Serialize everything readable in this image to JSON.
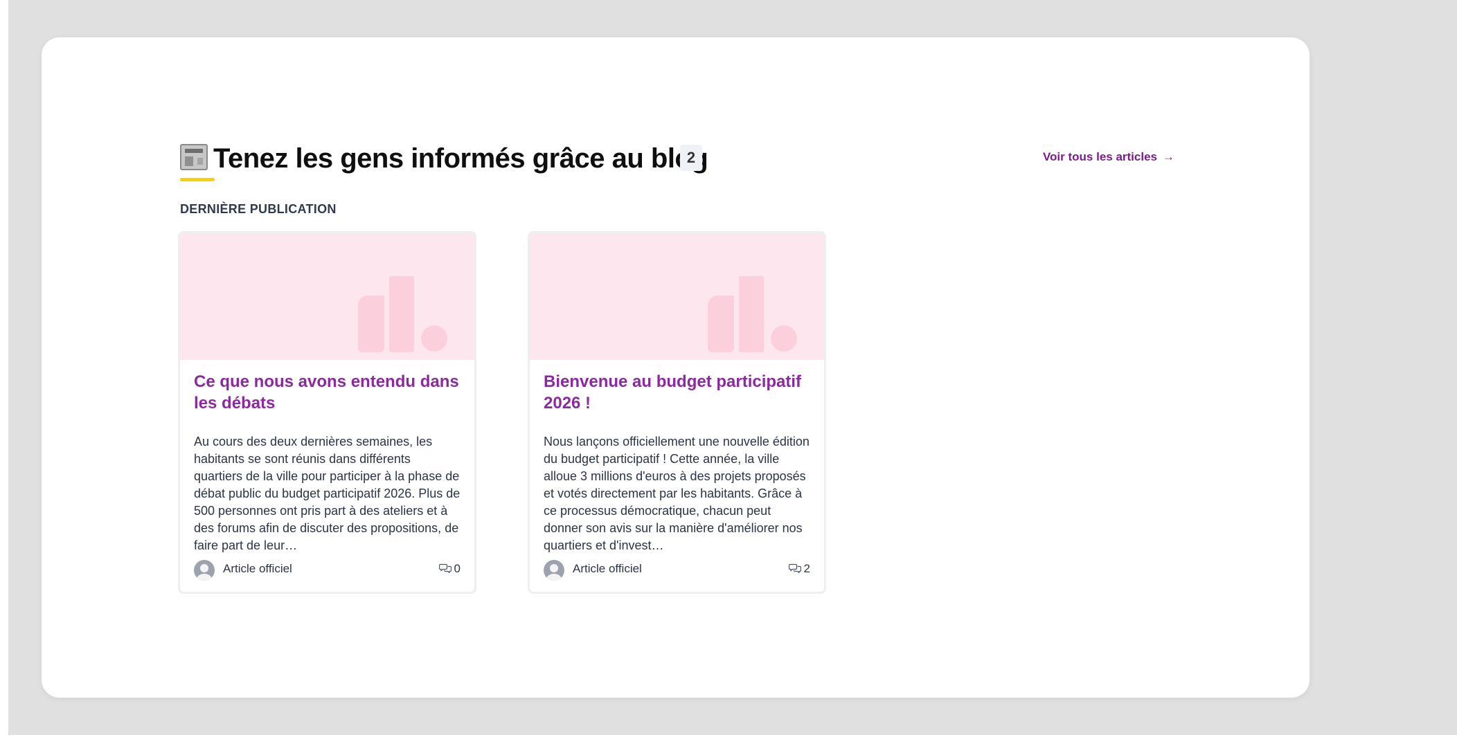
{
  "header": {
    "title": "Tenez les gens informés grâce au blog",
    "title_icon": "newspaper-icon",
    "count": "2",
    "see_all_label": "Voir tous les articles",
    "see_all_arrow": "→"
  },
  "section_label": "DERNIÈRE PUBLICATION",
  "colors": {
    "accent_title": "#8b2a9e",
    "link": "#7b1c8b",
    "underline": "#f6d200",
    "placeholder_bg": "#fde6ed"
  },
  "cards": [
    {
      "title": "Ce que nous avons entendu dans les débats",
      "excerpt": "Au cours des deux dernières semaines, les habitants se sont réunis dans différents quartiers de la ville pour participer à la phase de débat public du budget participatif 2026. Plus de 500 personnes ont pris part à des ateliers et à des forums afin de discuter des propositions, de faire part de leur…",
      "author": "Article officiel",
      "comments": "0"
    },
    {
      "title": "Bienvenue au budget participatif 2026 !",
      "excerpt": "Nous lançons officiellement une nouvelle édition du budget participatif ! Cette année, la ville alloue 3 millions d'euros à des projets proposés et votés directement par les habitants. Grâce à ce processus démocratique, chacun peut donner son avis sur la manière d'améliorer nos quartiers et d'invest…",
      "author": "Article officiel",
      "comments": "2"
    }
  ]
}
